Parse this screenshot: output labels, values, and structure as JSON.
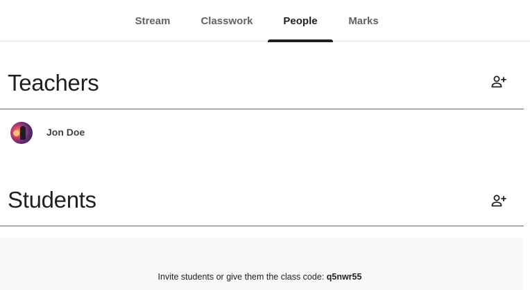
{
  "tabs": {
    "stream": "Stream",
    "classwork": "Classwork",
    "people": "People",
    "marks": "Marks",
    "active": "People"
  },
  "teachers": {
    "title": "Teachers",
    "items": [
      {
        "name": "Jon Doe",
        "avatar_icon": "user-photo"
      }
    ],
    "add_icon": "person-add-icon"
  },
  "students": {
    "title": "Students",
    "add_icon": "person-add-icon",
    "invite_text": "Invite students or give them the class code:",
    "class_code": "q5nwr55"
  },
  "colors": {
    "text_primary": "#202124",
    "text_secondary": "#5f6368",
    "divider": "#5f6368",
    "panel_bg": "#f8f9fa"
  }
}
